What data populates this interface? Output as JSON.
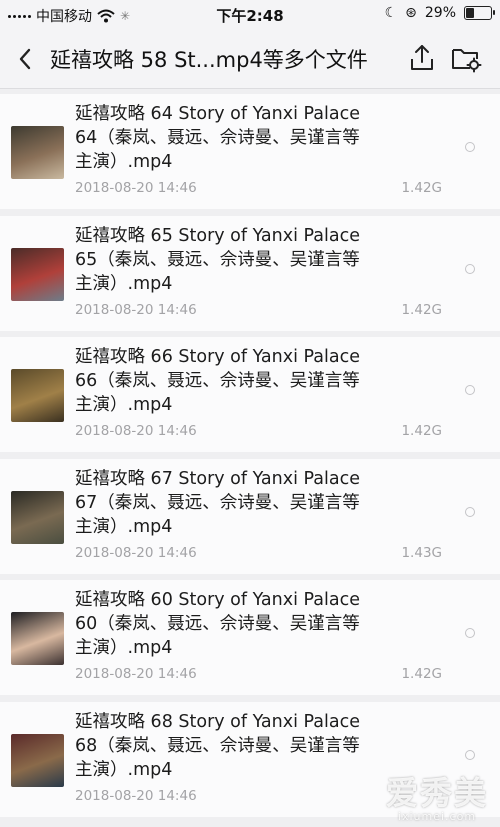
{
  "status_bar": {
    "carrier": "中国移动",
    "time": "下午2:48",
    "battery_percent": "29%",
    "battery_level": 0.29
  },
  "header": {
    "title": "延禧攻略 58  St...mp4等多个文件",
    "back_icon": "chevron-left-icon",
    "upload_icon": "upload-icon",
    "folder_icon": "folder-settings-icon"
  },
  "files": [
    {
      "line1": "延禧攻略 64  Story of Yanxi Palace",
      "line2": "64（秦岚、聂远、佘诗曼、吴谨言等",
      "line3": "主演）.mp4",
      "date": "2018-08-20 14:46",
      "size": "1.42G",
      "colors": [
        "#3d3a30",
        "#8a7058",
        "#c9b9a0"
      ]
    },
    {
      "line1": "延禧攻略 65  Story of Yanxi Palace",
      "line2": "65（秦岚、聂远、佘诗曼、吴谨言等",
      "line3": "主演）.mp4",
      "date": "2018-08-20 14:46",
      "size": "1.42G",
      "colors": [
        "#4a2c28",
        "#b0403a",
        "#6d7d8a"
      ]
    },
    {
      "line1": "延禧攻略 66  Story of Yanxi Palace",
      "line2": "66（秦岚、聂远、佘诗曼、吴谨言等",
      "line3": "主演）.mp4",
      "date": "2018-08-20 14:46",
      "size": "1.42G",
      "colors": [
        "#5a4a2a",
        "#a08048",
        "#3a3020"
      ]
    },
    {
      "line1": "延禧攻略 67  Story of Yanxi Palace",
      "line2": "67（秦岚、聂远、佘诗曼、吴谨言等",
      "line3": "主演）.mp4",
      "date": "2018-08-20 14:46",
      "size": "1.43G",
      "colors": [
        "#2a2a24",
        "#7a6a52",
        "#4a4e40"
      ]
    },
    {
      "line1": "延禧攻略 60  Story of Yanxi Palace",
      "line2": "60（秦岚、聂远、佘诗曼、吴谨言等",
      "line3": "主演）.mp4",
      "date": "2018-08-20 14:46",
      "size": "1.42G",
      "colors": [
        "#1e1e22",
        "#d8b8a0",
        "#3a3030"
      ]
    },
    {
      "line1": "延禧攻略 68  Story of Yanxi Palace",
      "line2": "68（秦岚、聂远、佘诗曼、吴谨言等",
      "line3": "主演）.mp4",
      "date": "2018-08-20 14:46",
      "size": "",
      "colors": [
        "#5a2a2a",
        "#8a6a4a",
        "#2a3a4a"
      ]
    }
  ],
  "watermark": {
    "main": "爱秀美",
    "sub": "ixiumei.com"
  }
}
